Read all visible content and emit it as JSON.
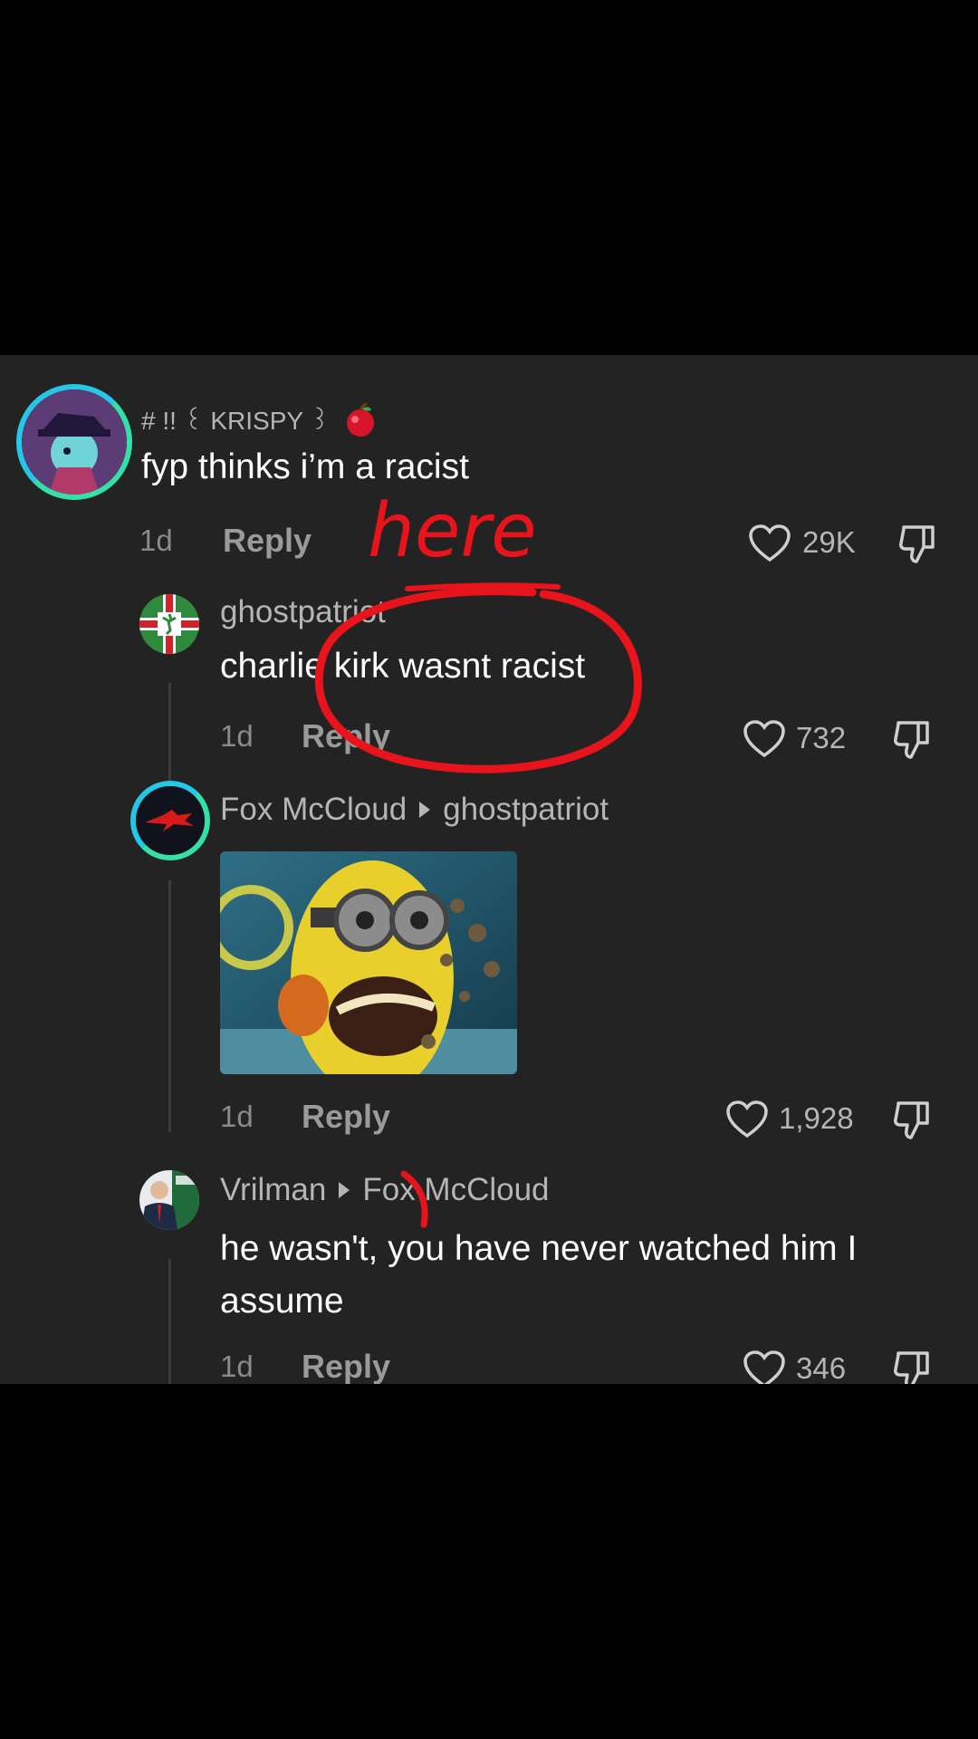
{
  "comments": [
    {
      "username": "# !! ꒰ KRISPY ꒱",
      "text": "fyp thinks i’m a racist",
      "time": "1d",
      "reply_label": "Reply",
      "likes": "29K"
    },
    {
      "username": "ghostpatriot",
      "text": "charlie kirk wasnt racist",
      "time": "1d",
      "reply_label": "Reply",
      "likes": "732"
    },
    {
      "username": "Fox McCloud",
      "reply_to": "ghostpatriot",
      "time": "1d",
      "reply_label": "Reply",
      "likes": "1,928"
    },
    {
      "username": "Vrilman",
      "reply_to": "Fox McCloud",
      "text": "he wasn't, you have never watched him I assume",
      "time": "1d",
      "reply_label": "Reply",
      "likes": "346"
    }
  ],
  "annotation": {
    "text": "here",
    "color": "#e8141c"
  },
  "colors": {
    "background": "#232323",
    "ring_start": "#25c7e6",
    "ring_end": "#35e0a8"
  },
  "icons": [
    "apple-icon",
    "heart-icon",
    "dislike-icon",
    "triangle-arrow-icon",
    "minion-gif"
  ]
}
